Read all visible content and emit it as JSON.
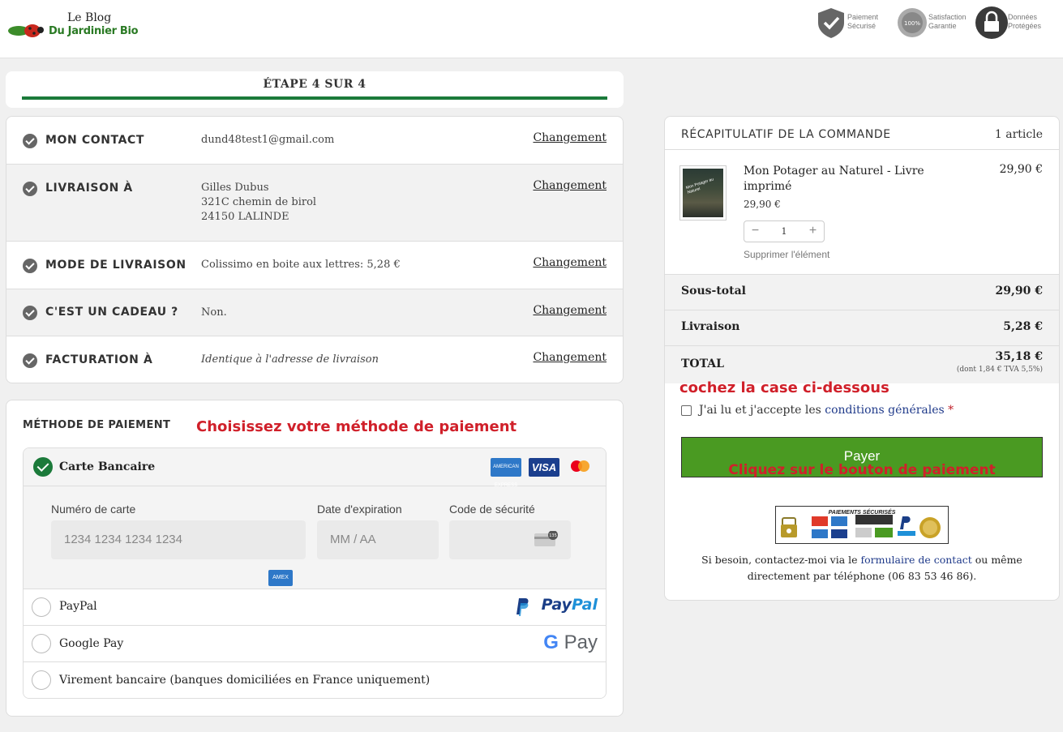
{
  "header": {
    "logo_line1": "Le Blog",
    "logo_line2": "Du Jardinier Bio",
    "badges": [
      {
        "icon": "shield-check-icon",
        "text": "Paiement\nSécurisé"
      },
      {
        "icon": "satisfaction-seal-icon",
        "text": "Satisfaction\nGarantie"
      },
      {
        "icon": "lock-icon",
        "text": "Données\nProtégées"
      }
    ]
  },
  "step": {
    "title": "ÉTAPE 4 SUR 4",
    "progress": 1.0
  },
  "summary": {
    "change_label": "Changement",
    "rows": [
      {
        "label": "MON CONTACT",
        "lines": [
          "dund48test1@gmail.com"
        ]
      },
      {
        "label": "LIVRAISON À",
        "lines": [
          "Gilles Dubus",
          "321C chemin de birol",
          "24150 LALINDE"
        ]
      },
      {
        "label": "MODE DE LIVRAISON",
        "lines": [
          "Colissimo en boite aux lettres: 5,28 €"
        ]
      },
      {
        "label": "C'EST UN CADEAU ?",
        "lines": [
          "Non."
        ]
      },
      {
        "label": "FACTURATION À",
        "lines": [
          "Identique à l'adresse de livraison"
        ]
      }
    ]
  },
  "payment": {
    "title": "MÉTHODE DE PAIEMENT",
    "annotation": "Choisissez votre méthode de paiement",
    "card": {
      "label": "Carte Bancaire",
      "logos": [
        "AMERICAN EXPRESS",
        "VISA",
        "mastercard"
      ],
      "number_label": "Numéro de carte",
      "number_placeholder": "1234 1234 1234 1234",
      "expiry_label": "Date d'expiration",
      "expiry_placeholder": "MM / AA",
      "cvc_label": "Code de sécurité",
      "cvc_badge": "135"
    },
    "paypal": {
      "label": "PayPal",
      "logo_a": "Pay",
      "logo_b": "Pal"
    },
    "googlepay": {
      "label": "Google Pay",
      "logo_g": "G",
      "logo_pay": "Pay"
    },
    "virement": {
      "label": "Virement bancaire (banques domiciliées en France uniquement)"
    }
  },
  "recap": {
    "title": "RÉCAPITULATIF DE LA COMMANDE",
    "count": "1 article",
    "product": {
      "name": "Mon Potager au Naturel - Livre imprimé",
      "unit_price": "29,90 €",
      "price": "29,90 €",
      "qty": "1",
      "cover_text": "Mon Potager au Naturel",
      "remove": "Supprimer l'élément"
    },
    "subtotal_label": "Sous-total",
    "subtotal": "29,90 €",
    "shipping_label": "Livraison",
    "shipping": "5,28 €",
    "total_label": "TOTAL",
    "total": "35,18 €",
    "tax_note": "(dont 1,84 € TVA 5,5%)",
    "annotation_check": "cochez la case ci-dessous",
    "terms_pre": "J'ai lu et j'accepte les ",
    "terms_link": "conditions générales",
    "terms_star": " *",
    "pay_button": "Payer",
    "annotation_pay": "Cliquez sur le bouton de paiement",
    "secure_title": "PAIEMENTS SÉCURISÉS",
    "contact_pre": "Si besoin, contactez-moi via le ",
    "contact_link": "formulaire de contact",
    "contact_post": " ou même directement par téléphone (06 83 53 46 86)."
  }
}
